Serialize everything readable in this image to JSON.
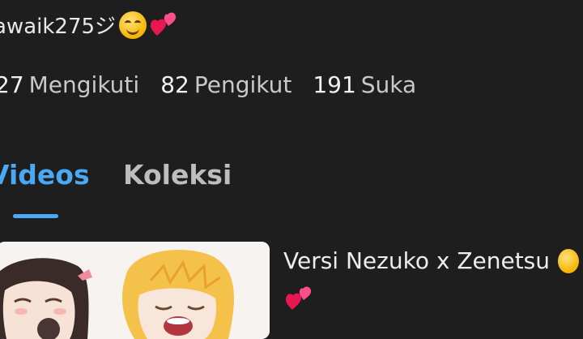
{
  "profile": {
    "username": "awaik275ジ",
    "username_emojis": [
      "smile-emoji",
      "two-hearts-emoji"
    ]
  },
  "stats": [
    {
      "number": "27",
      "label": "Mengikuti"
    },
    {
      "number": "82",
      "label": "Pengikut"
    },
    {
      "number": "191",
      "label": "Suka"
    }
  ],
  "tabs": [
    {
      "label": "Videos",
      "active": true
    },
    {
      "label": "Koleksi",
      "active": false
    }
  ],
  "video": {
    "title": "Versi Nezuko x Zenetsu",
    "title_emojis": [
      "smile-emoji",
      "two-hearts-emoji"
    ]
  },
  "colors": {
    "background": "#1e1e1e",
    "accent": "#4aa8f5",
    "inactive_tab": "#bdbdbd"
  }
}
